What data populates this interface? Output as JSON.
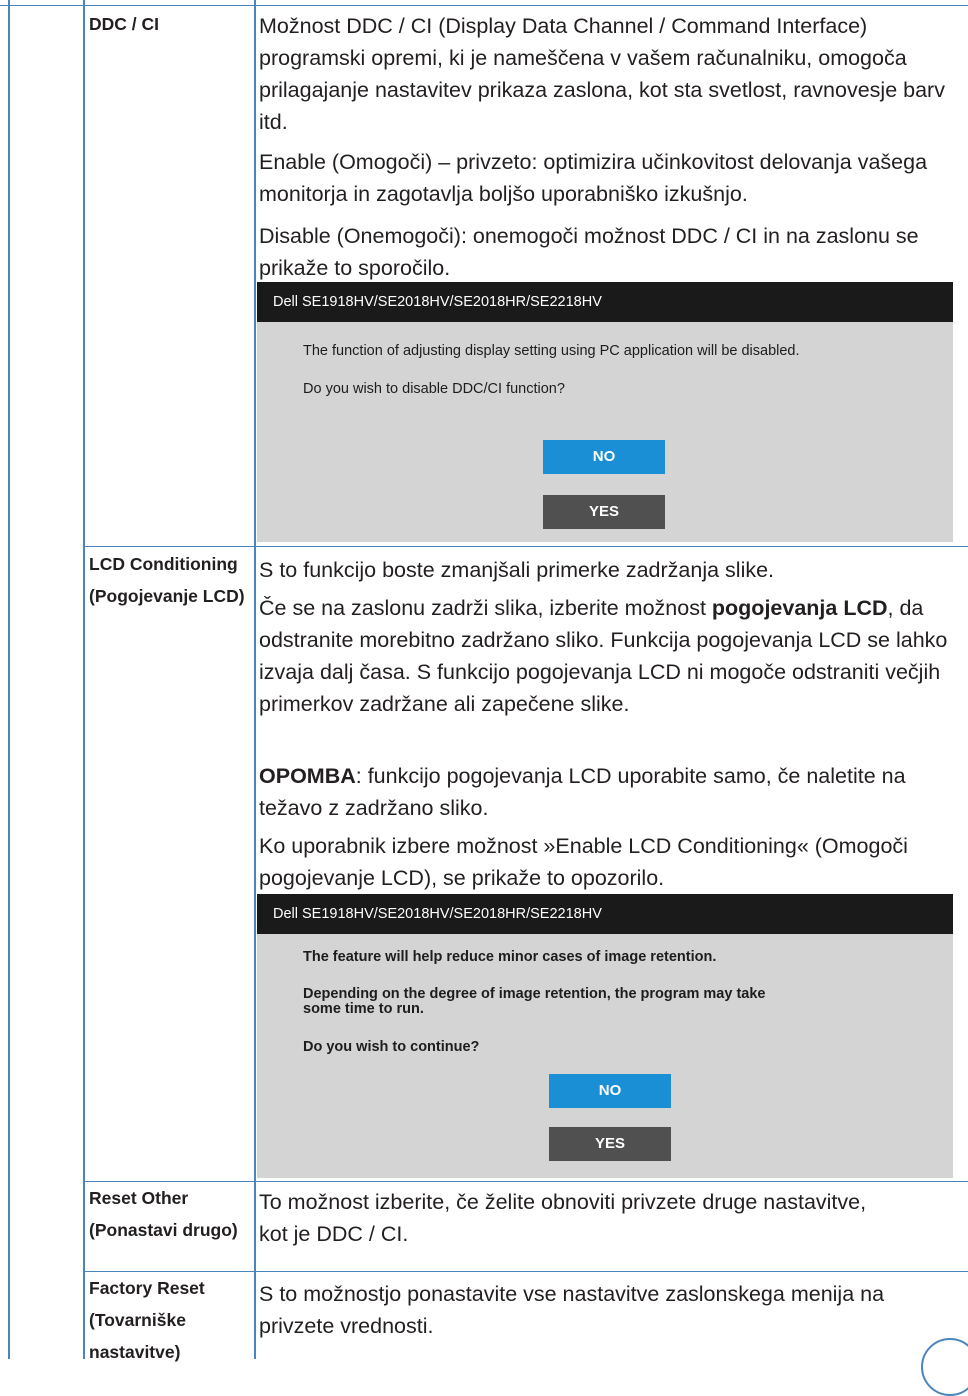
{
  "rows": [
    {
      "label": "DDC / CI",
      "paragraphs": [
        "Možnost DDC / CI (Display Data Channel / Command Interface) programski opremi, ki je nameščena v vašem računalniku, omogoča prilagajanje nastavitev prikaza zaslona, kot sta svetlost, ravnovesje barv itd.",
        "Enable (Omogoči) – privzeto: optimizira učinkovitost delovanja vašega monitorja in zagotavlja boljšo uporabniško izkušnjo.",
        "Disable (Onemogoči): onemogoči možnost DDC / CI in na zaslonu se prikaže to sporočilo."
      ],
      "dialog": {
        "title": "Dell SE1918HV/SE2018HV/SE2018HR/SE2218HV",
        "lines": [
          "The function of adjusting display setting using PC application will be disabled.",
          "Do you wish to disable DDC/CI function?"
        ],
        "no_label": "NO",
        "yes_label": "YES"
      }
    },
    {
      "label": "LCD Conditioning (Pogojevanje LCD)",
      "paragraphs": [
        "S to funkcijo boste zmanjšali primerke zadržanja slike.",
        {
          "before": "Če se na zaslonu zadrži slika, izberite možnost ",
          "bold": "pogojevanja LCD",
          "after": ", da odstranite morebitno zadržano sliko. Funkcija pogojevanja LCD se lahko izvaja dalj časa. S funkcijo pogojevanja LCD ni mogoče odstraniti večjih primerkov zadržane ali zapečene slike."
        },
        {
          "before": "",
          "bold": "OPOMBA",
          "after": ": funkcijo pogojevanja LCD uporabite samo, če naletite na težavo z zadržano sliko."
        },
        "Ko uporabnik izbere možnost »Enable LCD Conditioning« (Omogoči pogojevanje LCD), se prikaže to opozorilo."
      ],
      "dialog": {
        "title": "Dell SE1918HV/SE2018HV/SE2018HR/SE2218HV",
        "lines": [
          "The feature will help reduce minor cases of image retention.",
          "Depending on the degree of image retention, the program may take some time to run.",
          "Do you wish to continue?"
        ],
        "no_label": "NO",
        "yes_label": "YES"
      }
    },
    {
      "label": "Reset Other (Ponastavi drugo)",
      "paragraphs": [
        "To možnost izberite, če želite obnoviti privzete druge nastavitve, kot je DDC / CI."
      ]
    },
    {
      "label": "Factory Reset (Tovarniške nastavitve)",
      "paragraphs": [
        "S to možnostjo ponastavite vse nastavitve zaslonskega menija na privzete vrednosti."
      ]
    }
  ],
  "colors": {
    "table_border": "#4a86bd",
    "dialog_title_bg": "#1a1a1a",
    "dialog_body_bg": "#d4d4d4",
    "no_button": "#1a8fd6",
    "yes_button": "#505050"
  }
}
